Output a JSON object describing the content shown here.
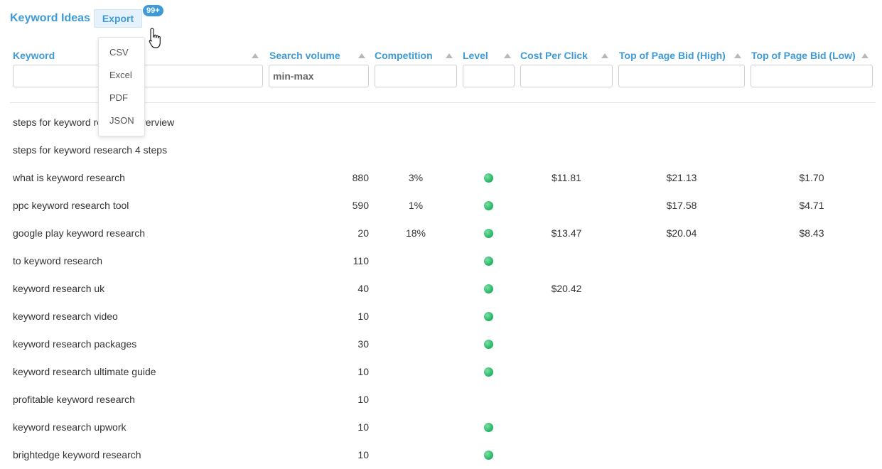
{
  "header": {
    "title": "Keyword Ideas",
    "export_label": "Export",
    "badge": "99+"
  },
  "export_menu": {
    "items": [
      "CSV",
      "Excel",
      "PDF",
      "JSON"
    ]
  },
  "columns": [
    {
      "label": "Keyword",
      "filter_placeholder": ""
    },
    {
      "label": "Search volume",
      "filter_placeholder": "min-max"
    },
    {
      "label": "Competition",
      "filter_placeholder": ""
    },
    {
      "label": "Level",
      "filter_placeholder": ""
    },
    {
      "label": "Cost Per Click",
      "filter_placeholder": ""
    },
    {
      "label": "Top of Page Bid (High)",
      "filter_placeholder": ""
    },
    {
      "label": "Top of Page Bid (Low)",
      "filter_placeholder": ""
    }
  ],
  "level_color": "#2bb869",
  "rows": [
    {
      "keyword": "steps for keyword research overview",
      "volume": "",
      "competition": "",
      "level": false,
      "cpc": "",
      "high": "",
      "low": ""
    },
    {
      "keyword": "steps for keyword research 4 steps",
      "volume": "",
      "competition": "",
      "level": false,
      "cpc": "",
      "high": "",
      "low": ""
    },
    {
      "keyword": "what is keyword research",
      "volume": "880",
      "competition": "3%",
      "level": true,
      "cpc": "$11.81",
      "high": "$21.13",
      "low": "$1.70"
    },
    {
      "keyword": "ppc keyword research tool",
      "volume": "590",
      "competition": "1%",
      "level": true,
      "cpc": "",
      "high": "$17.58",
      "low": "$4.71"
    },
    {
      "keyword": "google play keyword research",
      "volume": "20",
      "competition": "18%",
      "level": true,
      "cpc": "$13.47",
      "high": "$20.04",
      "low": "$8.43"
    },
    {
      "keyword": "to keyword research",
      "volume": "110",
      "competition": "",
      "level": true,
      "cpc": "",
      "high": "",
      "low": ""
    },
    {
      "keyword": "keyword research uk",
      "volume": "40",
      "competition": "",
      "level": true,
      "cpc": "$20.42",
      "high": "",
      "low": ""
    },
    {
      "keyword": "keyword research video",
      "volume": "10",
      "competition": "",
      "level": true,
      "cpc": "",
      "high": "",
      "low": ""
    },
    {
      "keyword": "keyword research packages",
      "volume": "30",
      "competition": "",
      "level": true,
      "cpc": "",
      "high": "",
      "low": ""
    },
    {
      "keyword": "keyword research ultimate guide",
      "volume": "10",
      "competition": "",
      "level": true,
      "cpc": "",
      "high": "",
      "low": ""
    },
    {
      "keyword": "profitable keyword research",
      "volume": "10",
      "competition": "",
      "level": false,
      "cpc": "",
      "high": "",
      "low": ""
    },
    {
      "keyword": "keyword research upwork",
      "volume": "10",
      "competition": "",
      "level": true,
      "cpc": "",
      "high": "",
      "low": ""
    },
    {
      "keyword": "brightedge keyword research",
      "volume": "10",
      "competition": "",
      "level": true,
      "cpc": "",
      "high": "",
      "low": ""
    }
  ]
}
